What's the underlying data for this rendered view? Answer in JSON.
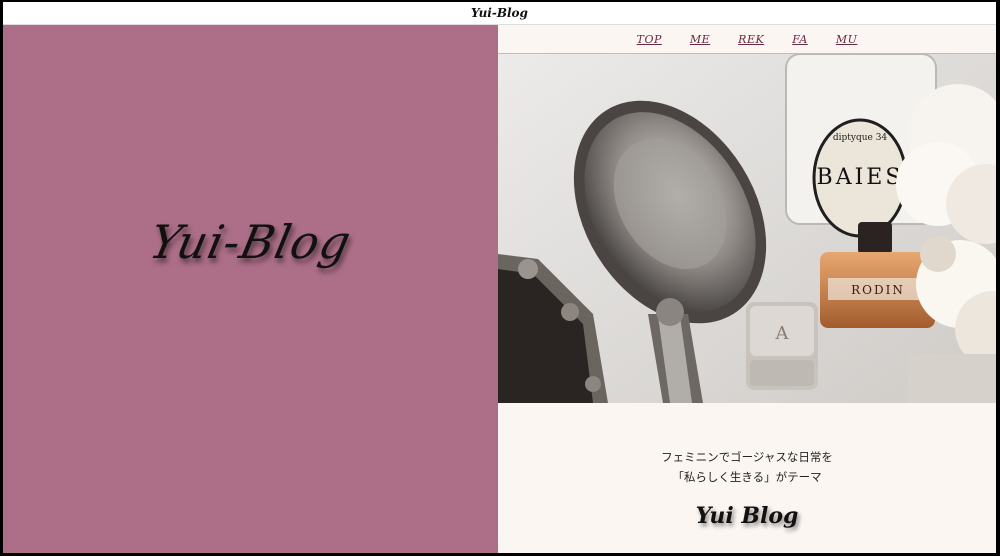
{
  "window": {
    "title": "Yui-Blog"
  },
  "left": {
    "logo_text": "Yui-Blog",
    "bg_color": "#ad6f88"
  },
  "nav": {
    "items": [
      "TOP",
      "ME",
      "REK",
      "FA",
      "MU"
    ]
  },
  "hero": {
    "candle_label_top": "diptyque 34",
    "candle_label_main": "BAIES",
    "perfume_label": "RODIN",
    "box_letter": "A"
  },
  "content": {
    "tagline_line1": "フェミニンでゴージャスな日常を",
    "tagline_line2": "「私らしく生きる」がテーマ",
    "blog_name": "Yui Blog"
  }
}
